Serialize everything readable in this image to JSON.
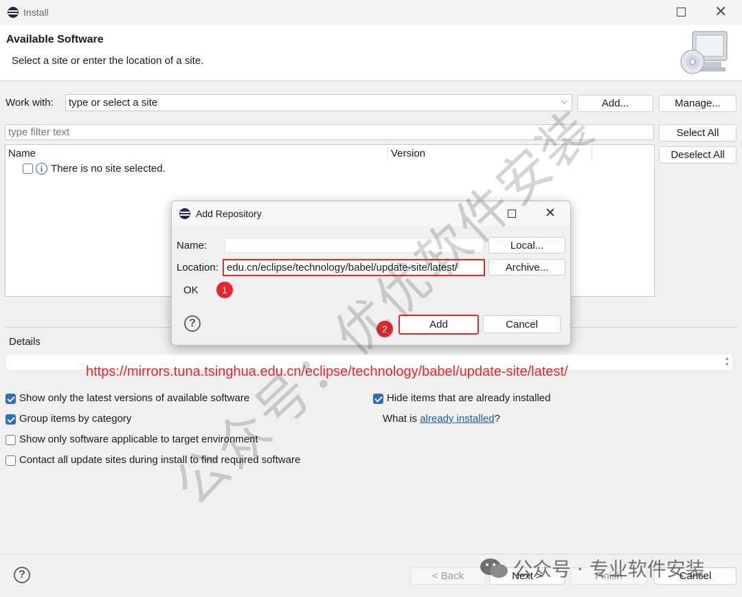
{
  "window": {
    "title": "Install"
  },
  "header": {
    "title": "Available Software",
    "subtitle": "Select a site or enter the location of a site."
  },
  "work_with": {
    "label": "Work with:",
    "placeholder": "type or select a site",
    "add_label": "Add...",
    "manage_label": "Manage..."
  },
  "filter": {
    "placeholder": "type filter text"
  },
  "buttons_right": {
    "select_all": "Select All",
    "deselect_all": "Deselect All"
  },
  "table": {
    "col_name": "Name",
    "col_version": "Version",
    "rows": [
      {
        "label": "There is no site selected."
      }
    ]
  },
  "details": {
    "label": "Details"
  },
  "annotation": {
    "url": "https://mirrors.tuna.tsinghua.edu.cn/eclipse/technology/babel/update-site/latest/",
    "step1": "1",
    "step2": "2"
  },
  "options": {
    "latest_versions": "Show only the latest versions of available software",
    "group_category": "Group items by category",
    "target_env": "Show only software applicable to target environment",
    "contact_sites": "Contact all update sites during install to find required software",
    "hide_installed": "Hide items that are already installed",
    "what_is_prefix": "What is ",
    "what_is_link": "already installed",
    "what_is_suffix": "?"
  },
  "footer": {
    "back": "< Back",
    "next": "Next >",
    "finish": "Finish",
    "cancel": "Cancel"
  },
  "dialog": {
    "title": "Add Repository",
    "name_label": "Name:",
    "name_value": "",
    "local_label": "Local...",
    "location_label": "Location:",
    "location_value": "edu.cn/eclipse/technology/babel/update-site/latest/",
    "archive_label": "Archive...",
    "ok_text": "OK",
    "add_label": "Add",
    "cancel_label": "Cancel"
  },
  "watermarks": {
    "diagonal": "公众号：优优软件安装",
    "footer": "公众号 · 专业软件安装"
  },
  "colors": {
    "annotation_red": "#e8262a",
    "link_blue": "#1a5fb4",
    "checkbox_blue": "#2f6bbf"
  }
}
